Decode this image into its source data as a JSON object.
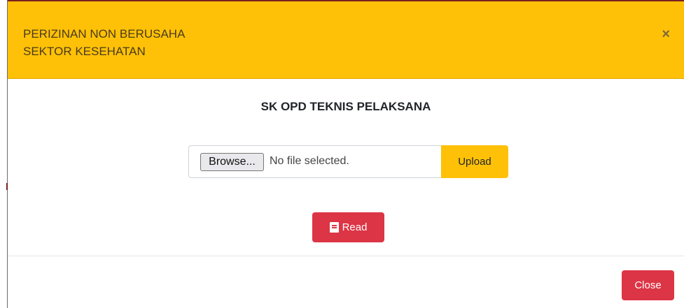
{
  "modal": {
    "title_line1": "PERIZINAN NON BERUSAHA",
    "title_line2": "SEKTOR KESEHATAN",
    "close_icon": "×"
  },
  "body": {
    "document_title": "SK OPD TEKNIS PELAKSANA",
    "browse_label": "Browse...",
    "file_status": "No file selected.",
    "upload_label": "Upload",
    "read_label": "Read",
    "read_icon": "book-icon"
  },
  "footer": {
    "close_label": "Close"
  },
  "colors": {
    "header": "#ffc107",
    "danger": "#dc3545"
  }
}
